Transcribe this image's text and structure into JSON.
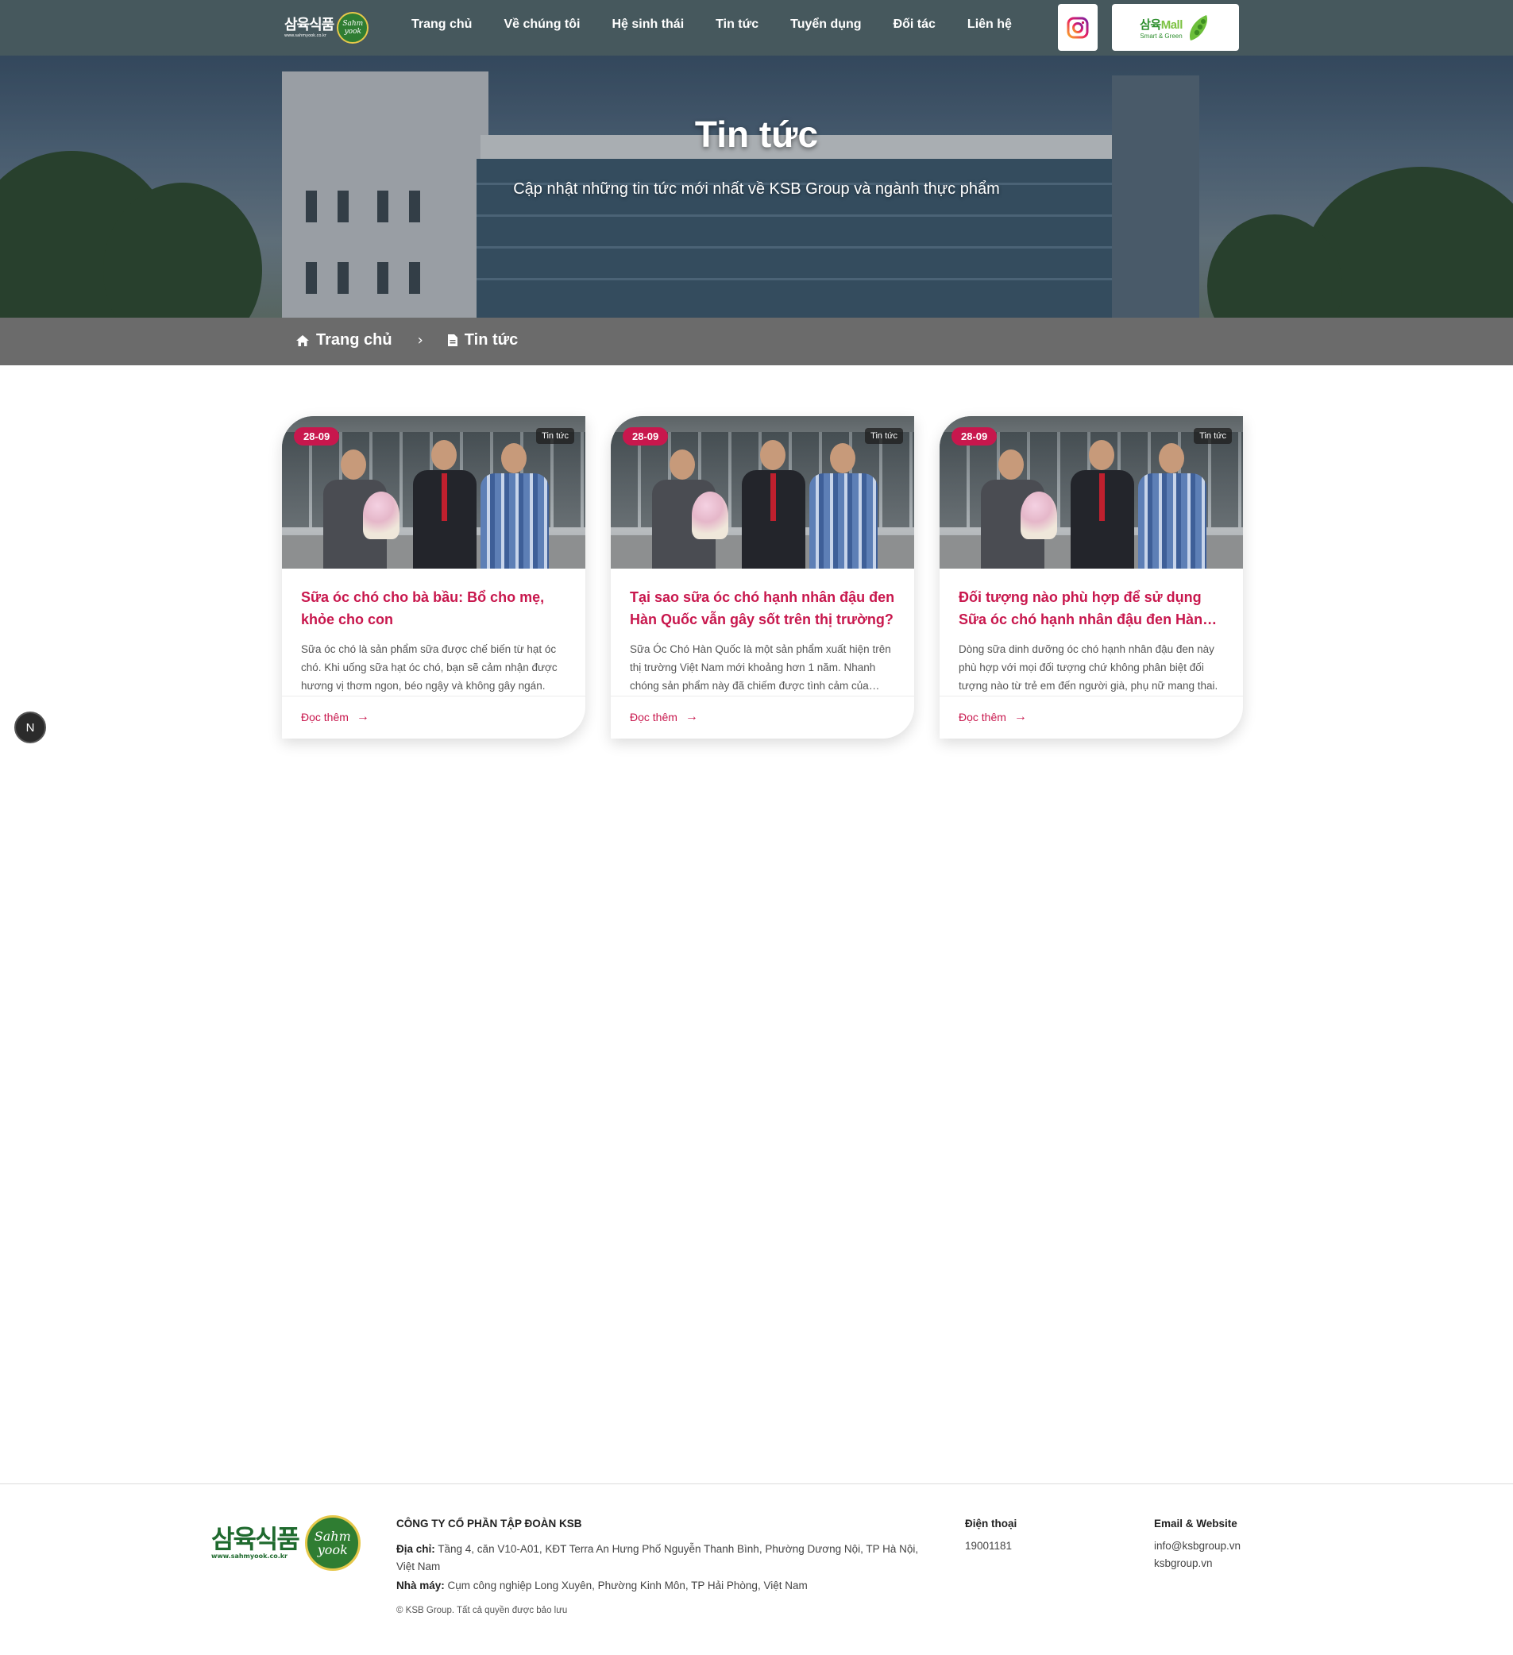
{
  "header": {
    "logo": {
      "korean": "삼육식품",
      "url": "www.sahmyook.co.kr",
      "badge": "Sahm yook"
    },
    "nav": [
      "Trang chủ",
      "Về chúng tôi",
      "Hệ sinh thái",
      "Tin tức",
      "Tuyển dụng",
      "Đối tác",
      "Liên hệ"
    ],
    "instagram_icon": "instagram-icon",
    "mall": {
      "name_ko": "삼육",
      "name_en": "Mall",
      "tagline": "Smart & Green"
    }
  },
  "hero": {
    "title": "Tin tức",
    "subtitle": "Cập nhật những tin tức mới nhất về KSB Group và ngành thực phẩm"
  },
  "breadcrumb": {
    "home": "Trang chủ",
    "separator": "›",
    "current": "Tin tức"
  },
  "cards": [
    {
      "date": "28-09",
      "category": "Tin tức",
      "title": "Sữa óc chó cho bà bầu: Bổ cho mẹ, khỏe cho con",
      "excerpt": "Sữa óc chó là sản phẩm sữa được chế biến từ hạt óc chó. Khi uống sữa hạt óc chó, bạn sẽ cảm nhận được hương vị thơm ngon, béo ngậy và không gây ngán.",
      "read_more": "Đọc thêm"
    },
    {
      "date": "28-09",
      "category": "Tin tức",
      "title": "Tại sao sữa óc chó hạnh nhân đậu đen Hàn Quốc vẫn gây sốt trên thị trường?",
      "excerpt": "Sữa Óc Chó Hàn Quốc là một sản phẩm xuất hiện trên thị trường Việt Nam mới khoảng hơn 1 năm. Nhanh chóng sản phẩm này đã chiếm được tình cảm của người tiêu dùng.",
      "read_more": "Đọc thêm"
    },
    {
      "date": "28-09",
      "category": "Tin tức",
      "title": "Đối tượng nào phù hợp để sử dụng Sữa óc chó hạnh nhân đậu đen Hàn Quốc?",
      "excerpt": "Dòng sữa dinh dưỡng óc chó hạnh nhân đậu đen này phù hợp với mọi đối tượng chứ không phân biệt đối tượng nào từ trẻ em đến người già, phụ nữ mang thai.",
      "read_more": "Đọc thêm"
    }
  ],
  "float_button": "N",
  "footer": {
    "logo": {
      "korean": "삼육식품",
      "url": "www.sahmyook.co.kr",
      "badge": "Sahm yook"
    },
    "company": "CÔNG TY CỔ PHẦN TẬP ĐOÀN KSB",
    "address_label": "Địa chỉ:",
    "address": "Tầng 4, căn V10-A01, KĐT Terra An Hưng Phố Nguyễn Thanh Bình, Phường Dương Nội, TP Hà Nội, Việt Nam",
    "factory_label": "Nhà máy:",
    "factory": "Cụm công nghiệp Long Xuyên, Phường Kinh Môn, TP Hải Phòng, Việt Nam",
    "copyright": "© KSB Group. Tất cả quyền được bảo lưu",
    "phone_title": "Điện thoại",
    "phone": "19001181",
    "email_title": "Email & Website",
    "email": "info@ksbgroup.vn",
    "website": "ksbgroup.vn"
  },
  "colors": {
    "header_bg": "#46585d",
    "accent": "#c8174d",
    "breadcrumb_bg": "#6b6b6b",
    "brand_green": "#2f7d32"
  }
}
